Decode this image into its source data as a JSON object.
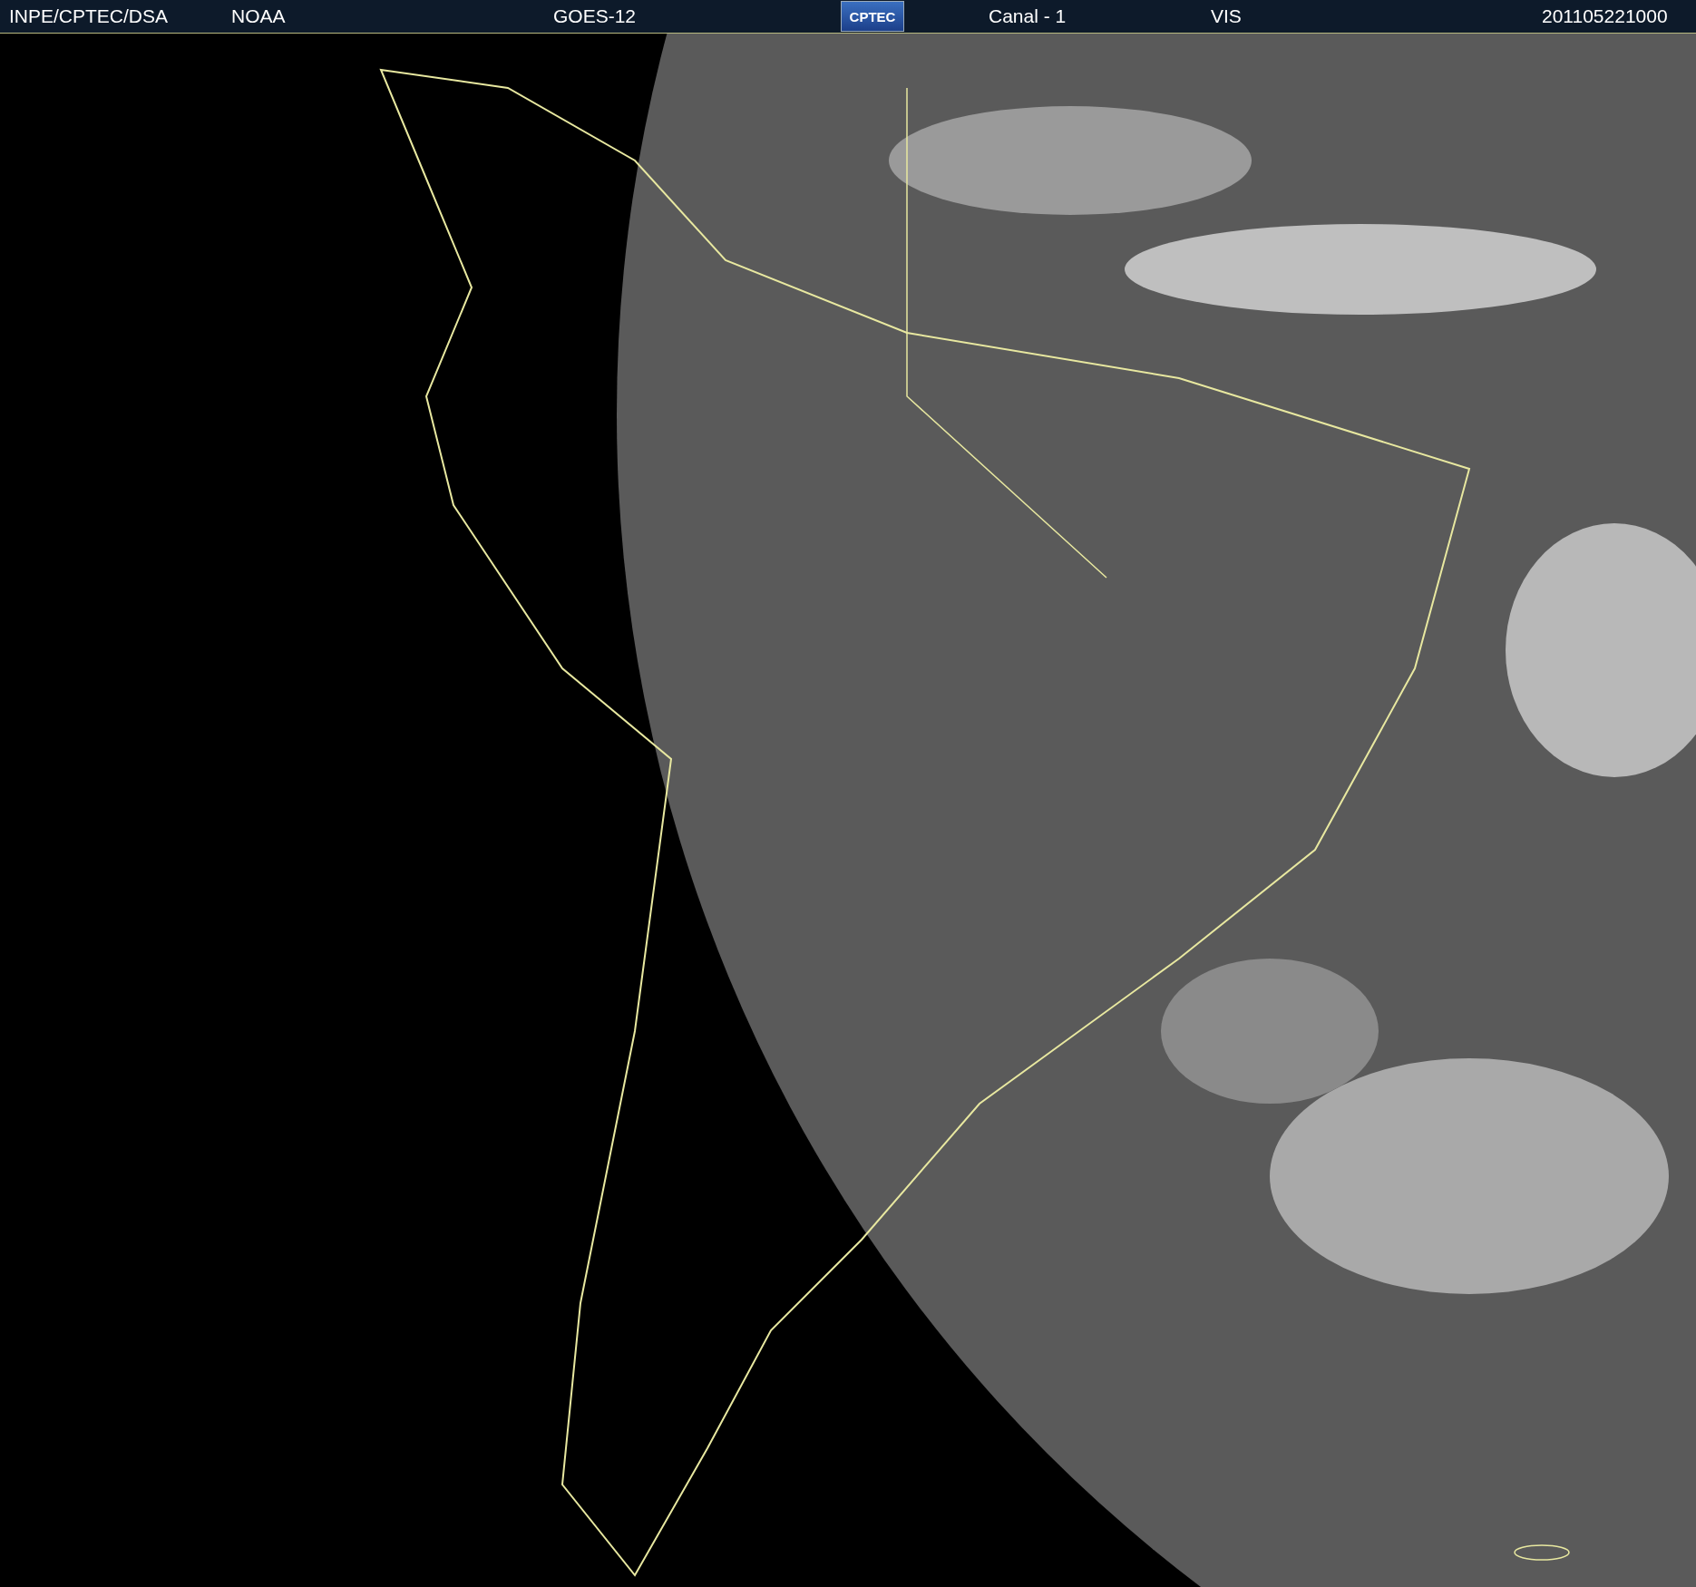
{
  "header": {
    "items": [
      {
        "kind": "text",
        "text": "INPE/CPTEC/DSA"
      },
      {
        "kind": "text",
        "text": "NOAA"
      },
      {
        "kind": "text",
        "text": "GOES-12"
      },
      {
        "kind": "logo",
        "text": "CPTEC"
      },
      {
        "kind": "text",
        "text": "Canal - 1"
      },
      {
        "kind": "text",
        "text": "VIS"
      },
      {
        "kind": "text",
        "text": "201105221000"
      }
    ]
  }
}
